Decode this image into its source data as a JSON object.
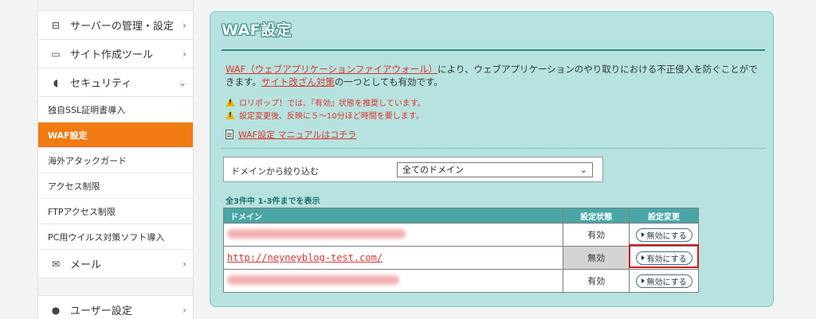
{
  "sidebar": {
    "items": [
      {
        "label": "サーバーの管理・設定",
        "icon": "server-icon",
        "glyph": "⊟",
        "chev": "›"
      },
      {
        "label": "サイト作成ツール",
        "icon": "laptop-icon",
        "glyph": "▭",
        "chev": "›"
      },
      {
        "label": "セキュリティ",
        "icon": "shield-icon",
        "glyph": "◖",
        "chev": "⌄"
      }
    ],
    "sub_items": [
      "独自SSL証明書導入",
      "WAF設定",
      "海外アタックガード",
      "アクセス制限",
      "FTPアクセス制限",
      "PC用ウイルス対策ソフト導入"
    ],
    "mail": {
      "label": "メール",
      "icon": "mail-icon",
      "glyph": "✉",
      "chev": "›"
    },
    "user": {
      "label": "ユーザー設定",
      "icon": "user-icon",
      "glyph": "●",
      "chev": "›"
    }
  },
  "panel": {
    "title": "WAF設定",
    "desc_link1": "WAF（ウェブアプリケーションファイアウォール）",
    "desc_text1": "により、ウェブアプリケーションのやり取りにおける不正侵入を防ぐことができます。",
    "desc_link2": "サイト改ざん対策",
    "desc_text2": "の一つとしても有効です。",
    "warnings": [
      "ロリポップ！では、『有効』状態を推奨しています。",
      "設定変更後、反映に５～10分ほど時間を要します。"
    ],
    "manual_link": "WAF設定 マニュアルはコチラ",
    "filter_label": "ドメインから絞り込む",
    "filter_value": "全てのドメイン",
    "count_text": "全3件中 1-3件までを表示",
    "table": {
      "headers": [
        "ドメイン",
        "設定状態",
        "設定変更"
      ],
      "rows": [
        {
          "domain": "",
          "status": "有効",
          "button": "無効にする"
        },
        {
          "domain": "http://neyneyblog-test.com/",
          "status": "無効",
          "button": "有効にする"
        },
        {
          "domain": "",
          "status": "有効",
          "button": "無効にする"
        }
      ]
    }
  }
}
